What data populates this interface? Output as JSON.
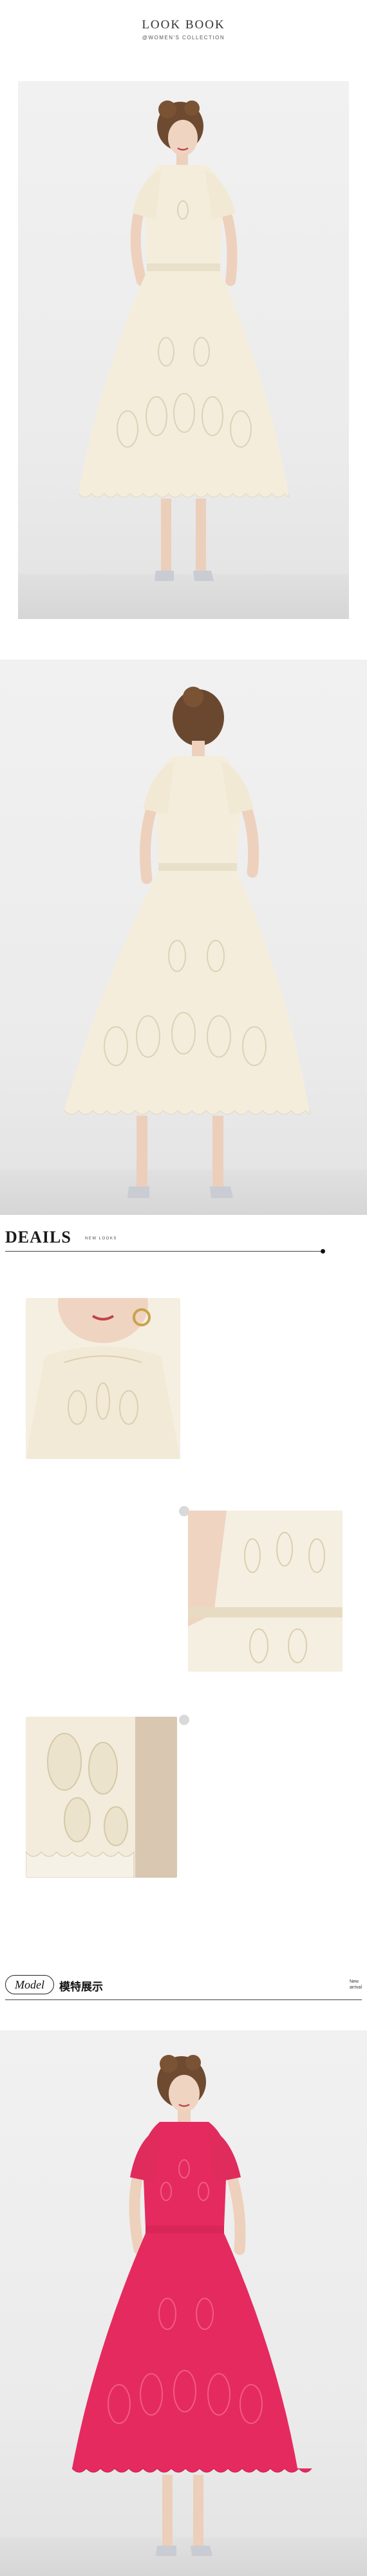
{
  "header": {
    "title": "LOOK BOOK",
    "subtitle": "@WOMEN'S COLLECTION"
  },
  "details": {
    "title": "DEAILS",
    "subtitle": "NEW LOOKS"
  },
  "model": {
    "pill_label": "Model",
    "cn_label": "模特展示",
    "side_text_line1": "New",
    "side_text_line2": "arrival"
  },
  "colors": {
    "cream_dress": "#f3ecd9",
    "pink_dress": "#e52a5f",
    "background": "#ffffff",
    "panel_bg": "#eeeeee"
  }
}
